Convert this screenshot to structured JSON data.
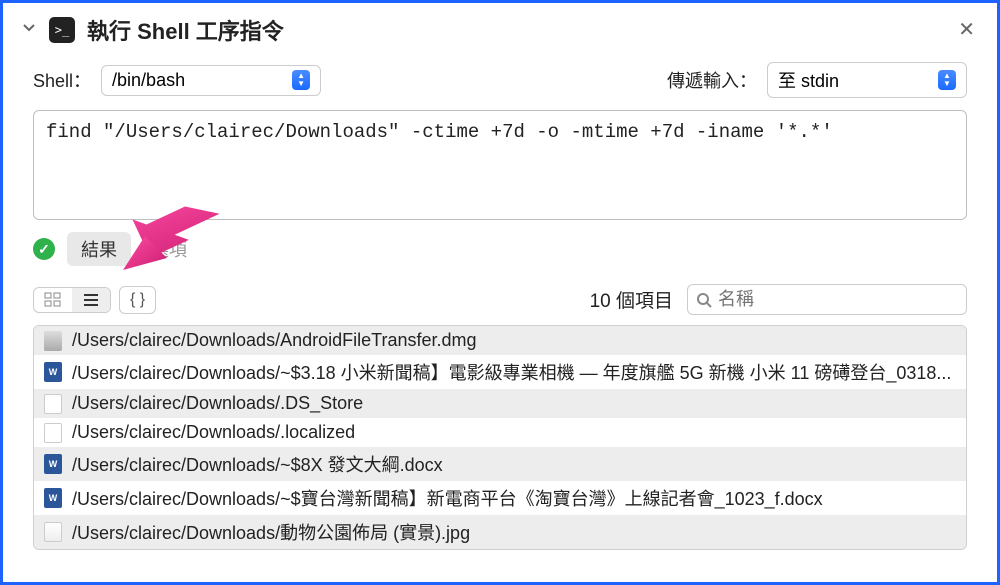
{
  "header": {
    "title": "執行 Shell 工序指令"
  },
  "config": {
    "shell_label": "Shell：",
    "shell_value": "/bin/bash",
    "input_label": "傳遞輸入：",
    "input_value": "至 stdin"
  },
  "command": "find \"/Users/clairec/Downloads\" -ctime +7d -o -mtime +7d -iname '*.*'",
  "tabs": {
    "results": "結果",
    "options": "選項"
  },
  "results": {
    "count_label": "10 個項目",
    "search_placeholder": "名稱",
    "items": [
      {
        "type": "dmg",
        "path": "/Users/clairec/Downloads/AndroidFileTransfer.dmg"
      },
      {
        "type": "docx",
        "path": "/Users/clairec/Downloads/~$3.18 小米新聞稿】電影級專業相機 — 年度旗艦 5G 新機 小米 11 磅礡登台_0318..."
      },
      {
        "type": "blank",
        "path": "/Users/clairec/Downloads/.DS_Store"
      },
      {
        "type": "blank",
        "path": "/Users/clairec/Downloads/.localized"
      },
      {
        "type": "docx",
        "path": "/Users/clairec/Downloads/~$8X 發文大綱.docx"
      },
      {
        "type": "docx",
        "path": "/Users/clairec/Downloads/~$寶台灣新聞稿】新電商平台《淘寶台灣》上線記者會_1023_f.docx"
      },
      {
        "type": "jpg",
        "path": "/Users/clairec/Downloads/動物公園佈局 (實景).jpg"
      }
    ]
  },
  "icons": {
    "grid": "⊞",
    "list": "≡",
    "braces": "{ }",
    "search": "🔍"
  }
}
